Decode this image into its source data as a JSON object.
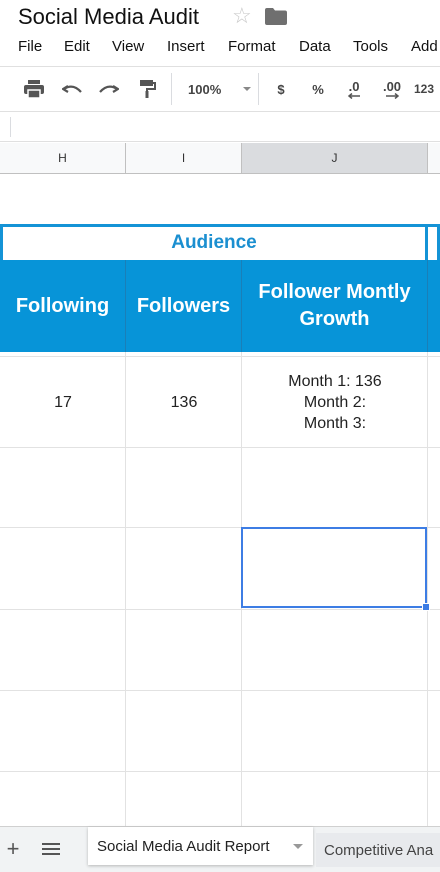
{
  "app": {
    "title": "Social Media Audit",
    "star_icon": "star-outline-icon",
    "folder_icon": "folder-icon"
  },
  "menu": [
    "File",
    "Edit",
    "View",
    "Insert",
    "Format",
    "Data",
    "Tools",
    "Add"
  ],
  "toolbar": {
    "zoom": "100%",
    "currency": "$",
    "percent": "%",
    "decrease_decimals": ".0",
    "increase_decimals": ".00",
    "more_formats": "123"
  },
  "columns": [
    "H",
    "I",
    "J"
  ],
  "sheet": {
    "group_header": "Audience",
    "headers": [
      "Following",
      "Followers",
      "Follower Montly Growth"
    ],
    "row": {
      "following": "17",
      "followers": "136",
      "growth_lines": [
        "Month 1: 136",
        "Month 2:",
        "Month 3:"
      ]
    }
  },
  "tabs": {
    "active": "Social Media Audit Report",
    "other": "Competitive Ana"
  },
  "colors": {
    "header_blue": "#0794d8",
    "audience_text": "#1b8fd0",
    "selection": "#3d7de4"
  }
}
